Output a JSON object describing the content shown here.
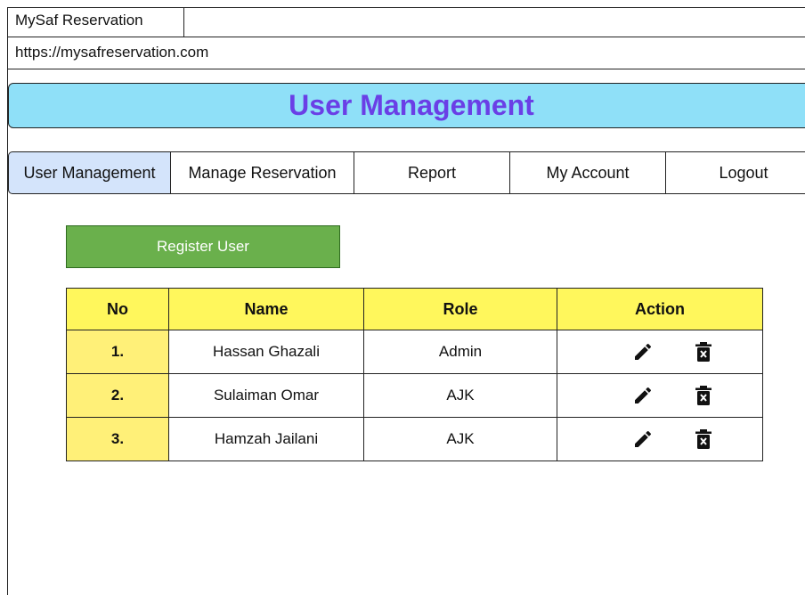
{
  "browser": {
    "tab_title": "MySaf Reservation",
    "url": "https://mysafreservation.com"
  },
  "banner": {
    "title": "User Management",
    "background_color": "#8fe0f8",
    "title_color": "#6a3fe6"
  },
  "nav": {
    "items": [
      {
        "label": "User Management",
        "active": true
      },
      {
        "label": "Manage Reservation",
        "active": false
      },
      {
        "label": "Report",
        "active": false
      },
      {
        "label": "My Account",
        "active": false
      },
      {
        "label": "Logout",
        "active": false
      }
    ]
  },
  "register_button": {
    "label": "Register User",
    "color": "#6ab04c"
  },
  "table": {
    "headers": [
      "No",
      "Name",
      "Role",
      "Action"
    ],
    "header_color": "#fff75c",
    "rows": [
      {
        "no": "1.",
        "name": "Hassan Ghazali",
        "role": "Admin",
        "actions": [
          "edit-icon",
          "delete-icon"
        ]
      },
      {
        "no": "2.",
        "name": "Sulaiman Omar",
        "role": "AJK",
        "actions": [
          "edit-icon",
          "delete-icon"
        ]
      },
      {
        "no": "3.",
        "name": "Hamzah Jailani",
        "role": "AJK",
        "actions": [
          "edit-icon",
          "delete-icon"
        ]
      }
    ]
  }
}
